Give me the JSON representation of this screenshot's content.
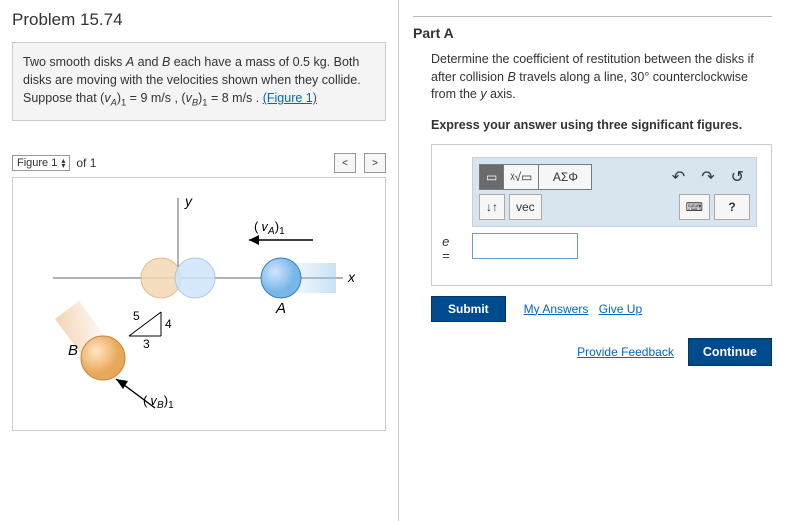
{
  "problem": {
    "title": "Problem 15.74",
    "text_html": "Two smooth disks <i>A</i> and <i>B</i> each have a mass of 0.5 kg. Both disks are moving with the velocities shown when they collide. Suppose that (<i>v<sub>A</sub></i>)<sub>1</sub> = 9 m/s , (<i>v<sub>B</sub></i>)<sub>1</sub> = 8 m/s . ",
    "figure_link": "(Figure 1)"
  },
  "figure": {
    "selector_label": "Figure 1",
    "count_label": "of 1",
    "labels": {
      "y": "y",
      "x": "x",
      "A": "A",
      "B": "B",
      "va1": "( v_A )_1",
      "vb1": "( v_B )_1",
      "tri_hyp": "5",
      "tri_opp": "4",
      "tri_adj": "3"
    }
  },
  "partA": {
    "title": "Part A",
    "instruction_html": "Determine the coefficient of restitution between the disks if after collision <i>B</i> travels along a line, 30° counterclockwise from the <i>y</i> axis.",
    "bold_line": "Express your answer using three significant figures.",
    "toolbar": {
      "template": "▭",
      "sqrt": "ᵡ√▭",
      "greek": "ΑΣΦ",
      "undo": "↶",
      "redo": "↷",
      "reset": "↺",
      "arrows": "↓↑",
      "vec": "vec",
      "keyboard": "⌨",
      "help": "?"
    },
    "answer_var": "e",
    "answer_value": "",
    "submit": "Submit",
    "my_answers": "My Answers",
    "give_up": "Give Up",
    "provide_feedback": "Provide Feedback",
    "continue": "Continue"
  }
}
